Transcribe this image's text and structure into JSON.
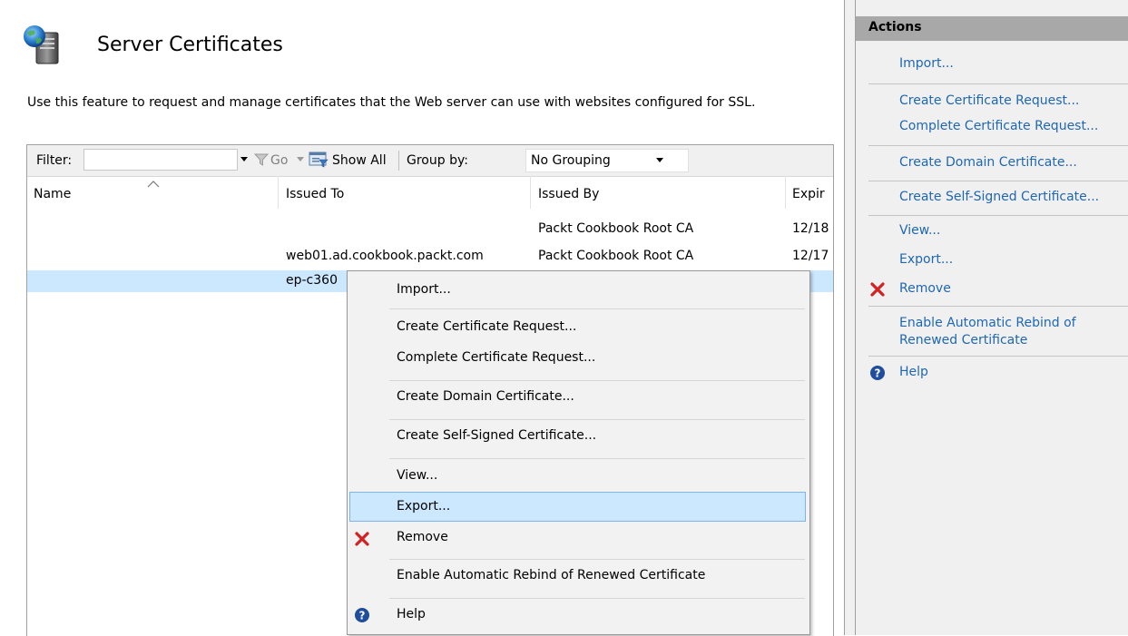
{
  "page": {
    "title": "Server Certificates",
    "description": "Use this feature to request and manage certificates that the Web server can use with websites configured for SSL."
  },
  "toolbar": {
    "filter_label": "Filter:",
    "filter_value": "",
    "go_label": "Go",
    "show_all_label": "Show All",
    "group_by_label": "Group by:",
    "group_by_value": "No Grouping"
  },
  "table": {
    "columns": [
      "Name",
      "Issued To",
      "Issued By",
      "Expir"
    ],
    "rows": [
      {
        "name": "",
        "issued_to": "",
        "issued_by": "Packt Cookbook Root CA",
        "expir": "12/18"
      },
      {
        "name": "",
        "issued_to": "web01.ad.cookbook.packt.com",
        "issued_by": "Packt Cookbook Root CA",
        "expir": "12/17"
      },
      {
        "name": "",
        "issued_to": "ep-c360",
        "issued_by": "",
        "expir": ""
      }
    ]
  },
  "context_menu": {
    "items": [
      {
        "label": "Import..."
      },
      {
        "label": "Create Certificate Request..."
      },
      {
        "label": "Complete Certificate Request..."
      },
      {
        "label": "Create Domain Certificate..."
      },
      {
        "label": "Create Self-Signed Certificate..."
      },
      {
        "label": "View..."
      },
      {
        "label": "Export...",
        "highlighted": true
      },
      {
        "label": "Remove",
        "icon": "remove-icon"
      },
      {
        "label": "Enable Automatic Rebind of Renewed Certificate"
      },
      {
        "label": "Help",
        "icon": "help-icon"
      }
    ]
  },
  "actions": {
    "title": "Actions",
    "items": [
      {
        "label": "Import..."
      },
      {
        "label": "Create Certificate Request..."
      },
      {
        "label": "Complete Certificate Request..."
      },
      {
        "label": "Create Domain Certificate..."
      },
      {
        "label": "Create Self-Signed Certificate..."
      },
      {
        "label": "View..."
      },
      {
        "label": "Export..."
      },
      {
        "label": "Remove",
        "icon": "remove-icon"
      },
      {
        "label": "Enable Automatic Rebind of Renewed Certificate"
      },
      {
        "label": "Help",
        "icon": "help-icon"
      }
    ]
  },
  "colors": {
    "selection": "#cce8ff",
    "link": "#1f67b1",
    "actions_header": "#a8a8a8",
    "remove_icon": "#d32020",
    "help_icon": "#1f4e9c"
  }
}
